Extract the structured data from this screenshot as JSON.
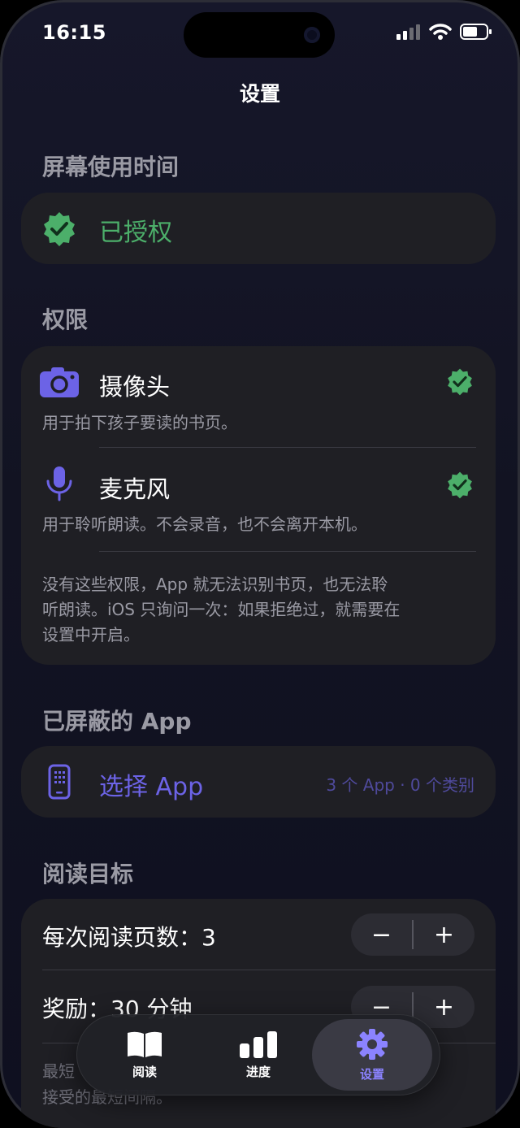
{
  "status": {
    "time": "16:15"
  },
  "nav": {
    "title": "设置"
  },
  "screen_time": {
    "header": "屏幕使用时间",
    "status_label": "已授权"
  },
  "permissions": {
    "header": "权限",
    "items": [
      {
        "title": "摄像头",
        "subtitle": "用于拍下孩子要读的书页。",
        "icon": "camera-icon",
        "granted": true
      },
      {
        "title": "麦克风",
        "subtitle": "用于聆听朗读。不会录音，也不会离开本机。",
        "icon": "microphone-icon",
        "granted": true
      }
    ],
    "footnote_lines": [
      "没有这些权限，App 就无法识别书页，也无法聆",
      "听朗读。iOS 只询问一次：如果拒绝过，就需要在",
      "设置中开启。"
    ]
  },
  "blocked_apps": {
    "header": "已屏蔽的 App",
    "select_label": "选择 App",
    "summary": "3 个 App · 0 个类别"
  },
  "reading_goal": {
    "header": "阅读目标",
    "pages_label": "每次阅读页数：3",
    "reward_label": "奖励：30 分钟",
    "minus": "−",
    "plus": "+",
    "footnote_lines": [
      "最短",
      "接受的最短间隔。"
    ]
  },
  "tabbar": {
    "tabs": [
      {
        "label": "阅读",
        "icon": "book-icon",
        "active": false
      },
      {
        "label": "进度",
        "icon": "bar-chart-icon",
        "active": false
      },
      {
        "label": "设置",
        "icon": "gear-icon",
        "active": true
      }
    ]
  },
  "colors": {
    "accent": "#6c63e6",
    "success": "#4caf6a",
    "card": "#1f1f24",
    "background": "#131424"
  }
}
